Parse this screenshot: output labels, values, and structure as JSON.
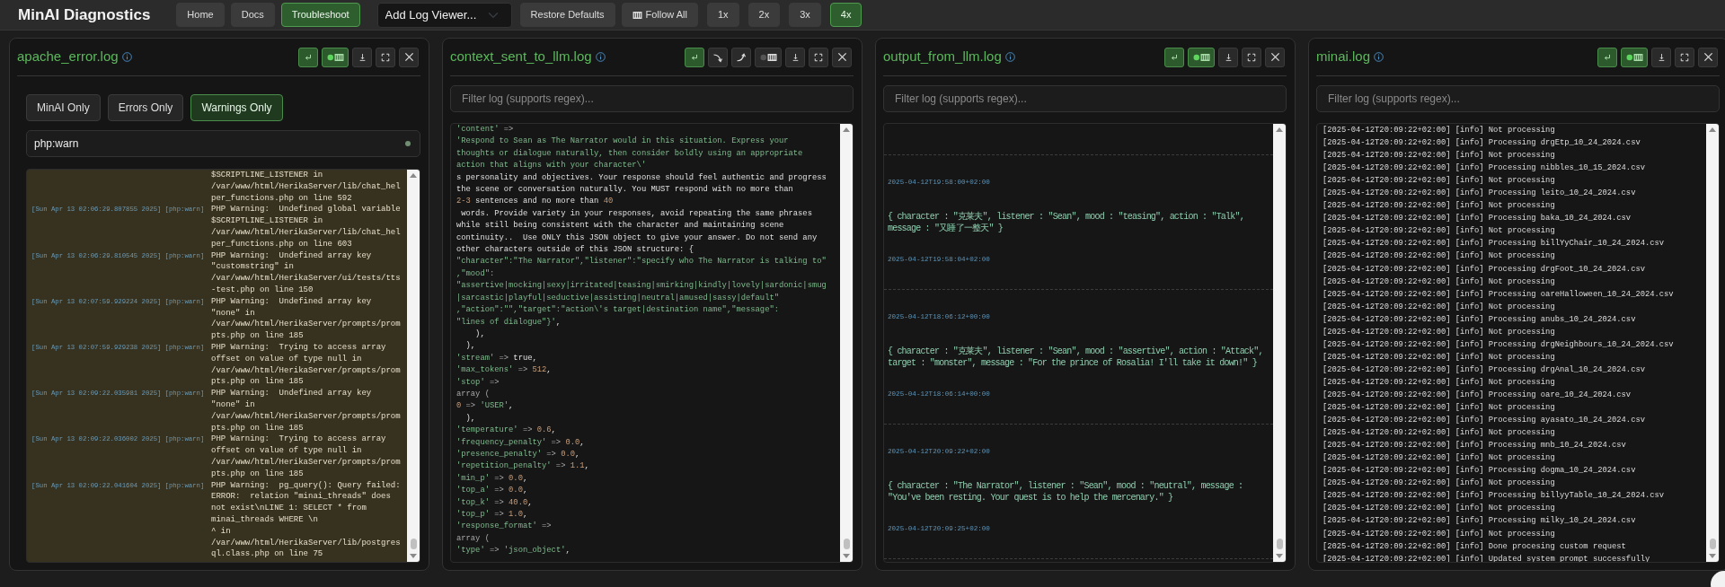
{
  "app": {
    "title": "MinAI Diagnostics"
  },
  "nav": [
    {
      "label": "Home",
      "selected": false
    },
    {
      "label": "Docs",
      "selected": false
    },
    {
      "label": "Troubleshoot",
      "selected": true
    }
  ],
  "log_viewer_select": {
    "value": "Add Log Viewer..."
  },
  "toolbar": [
    {
      "kind": "button",
      "label": "Restore Defaults"
    },
    {
      "kind": "follow",
      "label": "Follow All"
    }
  ],
  "zoom_levels": [
    {
      "label": "1x",
      "selected": false
    },
    {
      "label": "2x",
      "selected": false
    },
    {
      "label": "3x",
      "selected": false
    },
    {
      "label": "4x",
      "selected": true
    }
  ],
  "panels": [
    {
      "kind": "error_log",
      "title": "apache_error.log",
      "controls": [
        {
          "kind": "wrap",
          "on": true
        },
        {
          "kind": "follow",
          "on": true
        },
        {
          "kind": "download"
        },
        {
          "kind": "fullscreen"
        },
        {
          "kind": "close"
        }
      ],
      "type_filters": [
        {
          "label": "MinAI Only",
          "selected": false
        },
        {
          "label": "Errors Only",
          "selected": false
        },
        {
          "label": "Warnings Only",
          "selected": true
        }
      ],
      "level_filter": {
        "value": "php:warn"
      },
      "entries": [
        {
          "message": "$SCRIPTLINE_LISTENER in /var/www/html/HerikaServer/lib/chat_helper_functions.php on line 592"
        },
        {
          "time": "[Sun Apr 13 02:06:29.807855 2025]",
          "level": "[php:warn]",
          "message": "PHP Warning:  Undefined global variable $SCRIPTLINE_LISTENER in /var/www/html/HerikaServer/lib/chat_helper_functions.php on line 603"
        },
        {
          "time": "[Sun Apr 13 02:06:29.810545 2025]",
          "level": "[php:warn]",
          "message": "PHP Warning:  Undefined array key \"customstring\" in /var/www/html/HerikaServer/ui/tests/tts-test.php on line 150"
        },
        {
          "time": "[Sun Apr 13 02:07:59.929224 2025]",
          "level": "[php:warn]",
          "message": "PHP Warning:  Undefined array key \"none\" in /var/www/html/HerikaServer/prompts/prompts.php on line 185"
        },
        {
          "time": "[Sun Apr 13 02:07:59.929238 2025]",
          "level": "[php:warn]",
          "message": "PHP Warning:  Trying to access array offset on value of type null in /var/www/html/HerikaServer/prompts/prompts.php on line 185"
        },
        {
          "time": "[Sun Apr 13 02:09:22.035981 2025]",
          "level": "[php:warn]",
          "message": "PHP Warning:  Undefined array key \"none\" in /var/www/html/HerikaServer/prompts/prompts.php on line 185"
        },
        {
          "time": "[Sun Apr 13 02:09:22.036002 2025]",
          "level": "[php:warn]",
          "message": "PHP Warning:  Trying to access array offset on value of type null in /var/www/html/HerikaServer/prompts/prompts.php on line 185"
        },
        {
          "time": "[Sun Apr 13 02:09:22.041604 2025]",
          "level": "[php:warn]",
          "message": "PHP Warning:  pg_query(): Query failed: ERROR:  relation \"minai_threads\" does not exist\\nLINE 1: SELECT * from minai_threads WHERE \\n\n^ in /var/www/html/HerikaServer/lib/postgresql.class.php on line 75"
        }
      ]
    },
    {
      "kind": "code",
      "title": "context_sent_to_llm.log",
      "controls": [
        {
          "kind": "wrap",
          "on": true
        },
        {
          "kind": "scroll-down"
        },
        {
          "kind": "scroll-up"
        },
        {
          "kind": "follow",
          "on": false
        },
        {
          "kind": "download"
        },
        {
          "kind": "fullscreen"
        },
        {
          "kind": "close"
        }
      ],
      "filter": {
        "placeholder": "Filter log (supports regex)..."
      },
      "lines": [
        [
          {
            "kind": "string",
            "text": "'content'"
          },
          {
            "kind": "op",
            "text": " =>"
          }
        ],
        [
          {
            "kind": "string",
            "text": "'Respond to Sean as The Narrator would in this situation. Express your"
          }
        ],
        [
          {
            "kind": "string",
            "text": "thoughts or dialogue naturally, then consider boldly using an appropriate"
          }
        ],
        [
          {
            "kind": "string",
            "text": "action that aligns with your character\\'"
          }
        ],
        [
          {
            "kind": "plain",
            "text": "s personality and objectives. Your response should feel authentic and progress"
          }
        ],
        [
          {
            "kind": "plain",
            "text": "the scene or conversation naturally. You MUST respond with no more than"
          }
        ],
        [
          {
            "kind": "number",
            "text": "2-3"
          },
          {
            "kind": "plain",
            "text": " sentences and no more than "
          },
          {
            "kind": "number",
            "text": "40"
          }
        ],
        [
          {
            "kind": "plain",
            "text": " words. Provide variety in your responses, avoid repeating the same phrases"
          }
        ],
        [
          {
            "kind": "plain",
            "text": "while still being consistent with the character and maintaining scene"
          }
        ],
        [
          {
            "kind": "plain",
            "text": "continuity..  Use ONLY this JSON object to give your answer. Do not send any"
          }
        ],
        [
          {
            "kind": "plain",
            "text": "other characters outside of this JSON structure: {"
          }
        ],
        [
          {
            "kind": "string",
            "text": "\"character\":\"The Narrator\",\"listener\":\"specify who The Narrator is talking to\""
          }
        ],
        [
          {
            "kind": "string",
            "text": ",\"mood\":"
          }
        ],
        [
          {
            "kind": "string",
            "text": "\"assertive|mocking|sexy|irritated|teasing|smirking|kindly|lovely|sardonic|smug"
          }
        ],
        [
          {
            "kind": "string",
            "text": "|sarcastic|playful|seductive|assisting|neutral|amused|sassy|default\""
          }
        ],
        [
          {
            "kind": "string",
            "text": ",\"action\":\"\",\"target\":\"action\\'s target|destination name\",\"message\":"
          }
        ],
        [
          {
            "kind": "string",
            "text": "\"lines of dialogue\"}'"
          },
          {
            "kind": "plain",
            "text": ","
          }
        ],
        [
          {
            "kind": "plain",
            "text": "    ),"
          }
        ],
        [
          {
            "kind": "plain",
            "text": "  ),"
          }
        ],
        [
          {
            "kind": "string",
            "text": "'stream'"
          },
          {
            "kind": "op",
            "text": " => "
          },
          {
            "kind": "plain",
            "text": "true,"
          }
        ],
        [
          {
            "kind": "string",
            "text": "'max_tokens'"
          },
          {
            "kind": "op",
            "text": " => "
          },
          {
            "kind": "number",
            "text": "512"
          },
          {
            "kind": "plain",
            "text": ","
          }
        ],
        [
          {
            "kind": "string",
            "text": "'stop'"
          },
          {
            "kind": "op",
            "text": " =>"
          }
        ],
        [
          {
            "kind": "op",
            "text": "array ("
          }
        ],
        [
          {
            "kind": "number",
            "text": "0"
          },
          {
            "kind": "op",
            "text": " => "
          },
          {
            "kind": "string",
            "text": "'USER'"
          },
          {
            "kind": "plain",
            "text": ","
          }
        ],
        [
          {
            "kind": "plain",
            "text": "  ),"
          }
        ],
        [
          {
            "kind": "string",
            "text": "'temperature'"
          },
          {
            "kind": "op",
            "text": " => "
          },
          {
            "kind": "number",
            "text": "0.6"
          },
          {
            "kind": "plain",
            "text": ","
          }
        ],
        [
          {
            "kind": "string",
            "text": "'frequency_penalty'"
          },
          {
            "kind": "op",
            "text": " => "
          },
          {
            "kind": "number",
            "text": "0.0"
          },
          {
            "kind": "plain",
            "text": ","
          }
        ],
        [
          {
            "kind": "string",
            "text": "'presence_penalty'"
          },
          {
            "kind": "op",
            "text": " => "
          },
          {
            "kind": "number",
            "text": "0.0"
          },
          {
            "kind": "plain",
            "text": ","
          }
        ],
        [
          {
            "kind": "string",
            "text": "'repetition_penalty'"
          },
          {
            "kind": "op",
            "text": " => "
          },
          {
            "kind": "number",
            "text": "1.1"
          },
          {
            "kind": "plain",
            "text": ","
          }
        ],
        [
          {
            "kind": "string",
            "text": "'min_p'"
          },
          {
            "kind": "op",
            "text": " => "
          },
          {
            "kind": "number",
            "text": "0.0"
          },
          {
            "kind": "plain",
            "text": ","
          }
        ],
        [
          {
            "kind": "string",
            "text": "'top_a'"
          },
          {
            "kind": "op",
            "text": " => "
          },
          {
            "kind": "number",
            "text": "0.0"
          },
          {
            "kind": "plain",
            "text": ","
          }
        ],
        [
          {
            "kind": "string",
            "text": "'top_k'"
          },
          {
            "kind": "op",
            "text": " => "
          },
          {
            "kind": "number",
            "text": "40.0"
          },
          {
            "kind": "plain",
            "text": ","
          }
        ],
        [
          {
            "kind": "string",
            "text": "'top_p'"
          },
          {
            "kind": "op",
            "text": " => "
          },
          {
            "kind": "number",
            "text": "1.0"
          },
          {
            "kind": "plain",
            "text": ","
          }
        ],
        [
          {
            "kind": "string",
            "text": "'response_format'"
          },
          {
            "kind": "op",
            "text": " =>"
          }
        ],
        [
          {
            "kind": "op",
            "text": "array ("
          }
        ],
        [
          {
            "kind": "string",
            "text": "'type'"
          },
          {
            "kind": "op",
            "text": " => "
          },
          {
            "kind": "string",
            "text": "'json_object'"
          },
          {
            "kind": "plain",
            "text": ","
          }
        ]
      ]
    },
    {
      "kind": "responses",
      "title": "output_from_llm.log",
      "controls": [
        {
          "kind": "wrap",
          "on": true
        },
        {
          "kind": "follow",
          "on": true
        },
        {
          "kind": "download"
        },
        {
          "kind": "fullscreen"
        },
        {
          "kind": "close"
        }
      ],
      "filter": {
        "placeholder": "Filter log (supports regex)..."
      },
      "entries": [
        {
          "start": "2025-04-12T19:58:00+02:00",
          "message": "{ character : \"克莱夫\", listener : \"Sean\", mood : \"teasing\", action : \"Talk\", message : \"又睡了一整天\" }",
          "end": "2025-04-12T19:58:04+02:00"
        },
        {
          "start": "2025-04-12T18:06:12+00:00",
          "message": "{ character : \"克莱夫\", listener : \"Sean\", mood : \"assertive\", action : \"Attack\", target : \"monster\", message : \"For the prince of Rosalia! I'll take it down!\" }",
          "end": "2025-04-12T18:06:14+00:00"
        },
        {
          "start": "2025-04-12T20:09:22+02:00",
          "message": "{ character : \"The Narrator\", listener : \"Sean\", mood : \"neutral\", message : \"You've been resting. Your quest is to help the mercenary.\" }",
          "end": "2025-04-12T20:09:25+02:00"
        }
      ]
    },
    {
      "kind": "lines",
      "title": "minai.log",
      "controls": [
        {
          "kind": "wrap",
          "on": true
        },
        {
          "kind": "follow",
          "on": true
        },
        {
          "kind": "download"
        },
        {
          "kind": "fullscreen"
        },
        {
          "kind": "close"
        }
      ],
      "filter": {
        "placeholder": "Filter log (supports regex)..."
      },
      "entries": [
        {
          "time": "[2025-04-12T20:09:22+02:00]",
          "level": "[info]",
          "message": "Not processing"
        },
        {
          "time": "[2025-04-12T20:09:22+02:00]",
          "level": "[info]",
          "message": "Processing drgEtp_10_24_2024.csv"
        },
        {
          "time": "[2025-04-12T20:09:22+02:00]",
          "level": "[info]",
          "message": "Not processing"
        },
        {
          "time": "[2025-04-12T20:09:22+02:00]",
          "level": "[info]",
          "message": "Processing nibbles_10_15_2024.csv"
        },
        {
          "time": "[2025-04-12T20:09:22+02:00]",
          "level": "[info]",
          "message": "Not processing"
        },
        {
          "time": "[2025-04-12T20:09:22+02:00]",
          "level": "[info]",
          "message": "Processing leito_10_24_2024.csv"
        },
        {
          "time": "[2025-04-12T20:09:22+02:00]",
          "level": "[info]",
          "message": "Not processing"
        },
        {
          "time": "[2025-04-12T20:09:22+02:00]",
          "level": "[info]",
          "message": "Processing baka_10_24_2024.csv"
        },
        {
          "time": "[2025-04-12T20:09:22+02:00]",
          "level": "[info]",
          "message": "Not processing"
        },
        {
          "time": "[2025-04-12T20:09:22+02:00]",
          "level": "[info]",
          "message": "Processing billYyChair_10_24_2024.csv"
        },
        {
          "time": "[2025-04-12T20:09:22+02:00]",
          "level": "[info]",
          "message": "Not processing"
        },
        {
          "time": "[2025-04-12T20:09:22+02:00]",
          "level": "[info]",
          "message": "Processing drgFoot_10_24_2024.csv"
        },
        {
          "time": "[2025-04-12T20:09:22+02:00]",
          "level": "[info]",
          "message": "Not processing"
        },
        {
          "time": "[2025-04-12T20:09:22+02:00]",
          "level": "[info]",
          "message": "Processing oareHalloween_10_24_2024.csv"
        },
        {
          "time": "[2025-04-12T20:09:22+02:00]",
          "level": "[info]",
          "message": "Not processing"
        },
        {
          "time": "[2025-04-12T20:09:22+02:00]",
          "level": "[info]",
          "message": "Processing anubs_10_24_2024.csv"
        },
        {
          "time": "[2025-04-12T20:09:22+02:00]",
          "level": "[info]",
          "message": "Not processing"
        },
        {
          "time": "[2025-04-12T20:09:22+02:00]",
          "level": "[info]",
          "message": "Processing drgNeighbours_10_24_2024.csv"
        },
        {
          "time": "[2025-04-12T20:09:22+02:00]",
          "level": "[info]",
          "message": "Not processing"
        },
        {
          "time": "[2025-04-12T20:09:22+02:00]",
          "level": "[info]",
          "message": "Processing drgAnal_10_24_2024.csv"
        },
        {
          "time": "[2025-04-12T20:09:22+02:00]",
          "level": "[info]",
          "message": "Not processing"
        },
        {
          "time": "[2025-04-12T20:09:22+02:00]",
          "level": "[info]",
          "message": "Processing oare_10_24_2024.csv"
        },
        {
          "time": "[2025-04-12T20:09:22+02:00]",
          "level": "[info]",
          "message": "Not processing"
        },
        {
          "time": "[2025-04-12T20:09:22+02:00]",
          "level": "[info]",
          "message": "Processing ayasato_10_24_2024.csv"
        },
        {
          "time": "[2025-04-12T20:09:22+02:00]",
          "level": "[info]",
          "message": "Not processing"
        },
        {
          "time": "[2025-04-12T20:09:22+02:00]",
          "level": "[info]",
          "message": "Processing mnb_10_24_2024.csv"
        },
        {
          "time": "[2025-04-12T20:09:22+02:00]",
          "level": "[info]",
          "message": "Not processing"
        },
        {
          "time": "[2025-04-12T20:09:22+02:00]",
          "level": "[info]",
          "message": "Processing dogma_10_24_2024.csv"
        },
        {
          "time": "[2025-04-12T20:09:22+02:00]",
          "level": "[info]",
          "message": "Not processing"
        },
        {
          "time": "[2025-04-12T20:09:22+02:00]",
          "level": "[info]",
          "message": "Processing billyyTable_10_24_2024.csv"
        },
        {
          "time": "[2025-04-12T20:09:22+02:00]",
          "level": "[info]",
          "message": "Not processing"
        },
        {
          "time": "[2025-04-12T20:09:22+02:00]",
          "level": "[info]",
          "message": "Processing milky_10_24_2024.csv"
        },
        {
          "time": "[2025-04-12T20:09:22+02:00]",
          "level": "[info]",
          "message": "Not processing"
        },
        {
          "time": "[2025-04-12T20:09:22+02:00]",
          "level": "[info]",
          "message": "Done procesing custom request"
        },
        {
          "time": "[2025-04-12T20:09:22+02:00]",
          "level": "[info]",
          "message": "Updated system prompt successfully"
        }
      ]
    }
  ]
}
